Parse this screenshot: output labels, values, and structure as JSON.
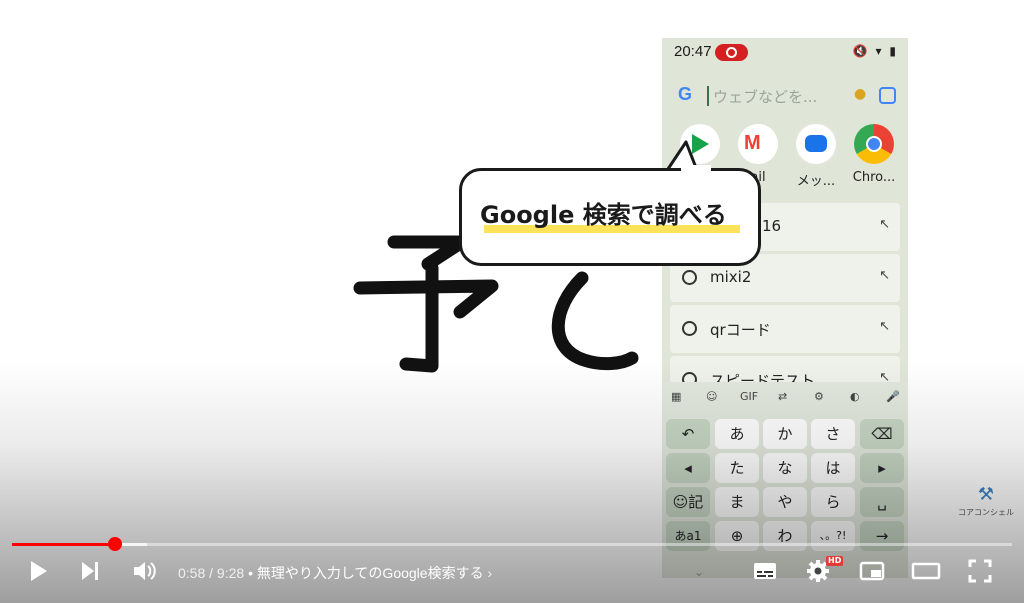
{
  "phone": {
    "status_time": "20:47",
    "status_icons": "🔇 ▾ ▮",
    "search_logo": "G",
    "search_placeholder": "ウェブなどを...",
    "apps": [
      {
        "label": "",
        "icon": "play-store-icon"
      },
      {
        "label": "ail",
        "icon": "gmail-icon"
      },
      {
        "label": "メッ...",
        "icon": "messages-icon"
      },
      {
        "label": "Chro...",
        "icon": "chrome-icon"
      }
    ],
    "history": [
      "16",
      "mixi2",
      "qrコード",
      "スピードテスト"
    ],
    "keyboard": {
      "toolbar": [
        "▦",
        "☺",
        "GIF",
        "⇄",
        "⚙",
        "◐",
        "🎤"
      ],
      "rows": [
        [
          "↶",
          "あ",
          "か",
          "さ",
          "⌫"
        ],
        [
          "◂",
          "た",
          "な",
          "は",
          "▸"
        ],
        [
          "☺記",
          "ま",
          "や",
          "ら",
          "␣"
        ],
        [
          "あa1",
          "⊕",
          "わ",
          "、。?!",
          "→"
        ]
      ]
    }
  },
  "callout": {
    "text": "Google 検索で調べる"
  },
  "watermark": {
    "text": "コアコンシェル"
  },
  "player": {
    "current_time": "0:58",
    "duration": "9:28",
    "separator": " / ",
    "chapter_title": "• 無理やり入力してのGoogle検索する",
    "chapter_chevron": "›",
    "played_fraction": 0.103,
    "buffered_fraction": 0.135,
    "hd_badge": "HD"
  }
}
